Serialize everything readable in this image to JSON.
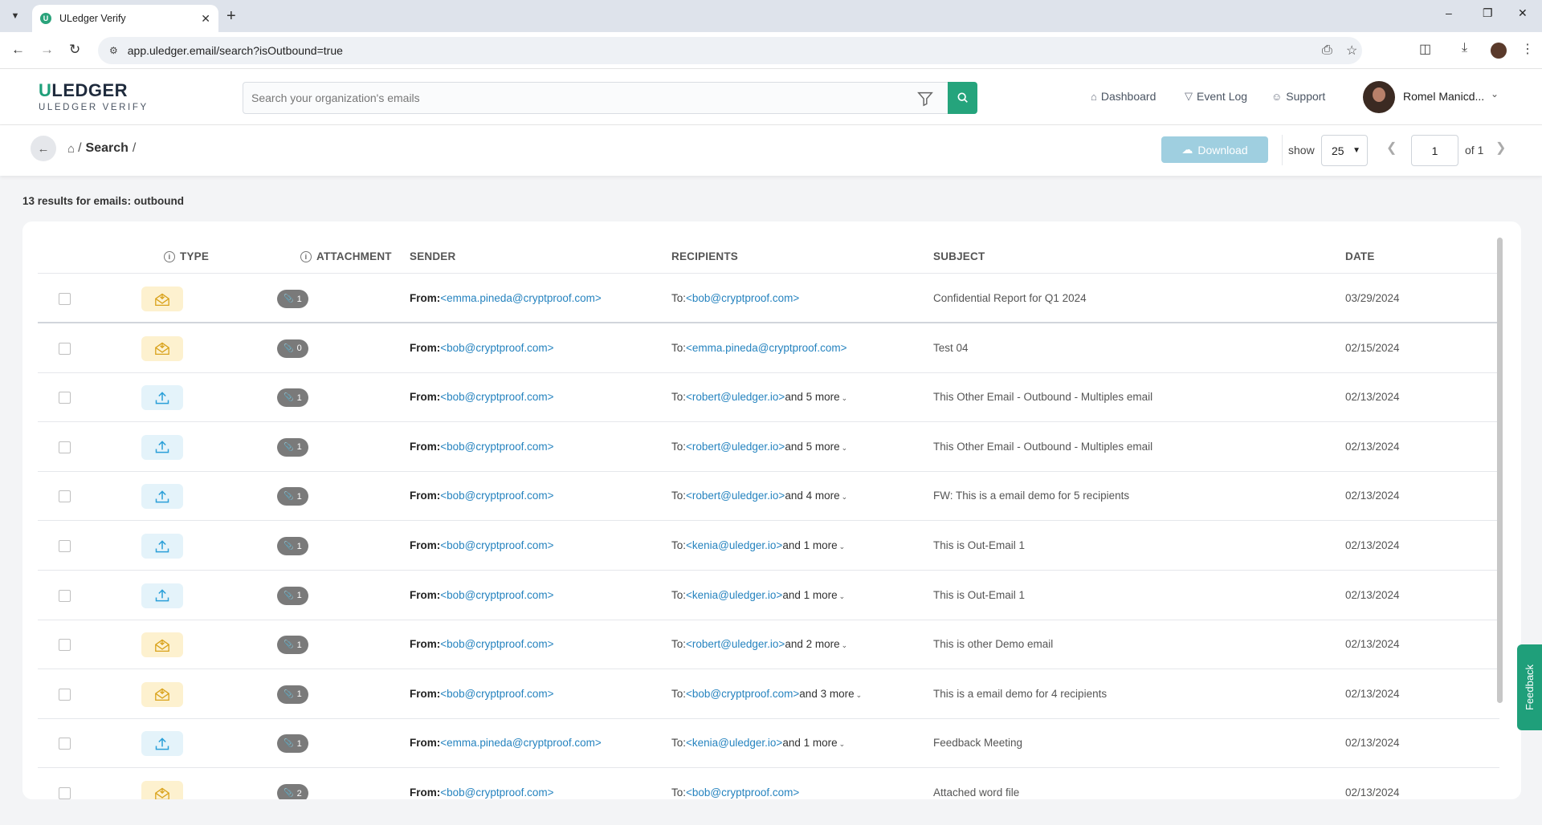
{
  "browser": {
    "tab_title": "ULedger Verify",
    "url": "app.uledger.email/search?isOutbound=true",
    "site_info_icon": "tune-icon"
  },
  "header": {
    "logo_text": "ULEDGER",
    "logo_subtitle": "ULEDGER VERIFY",
    "search_placeholder": "Search your organization's emails",
    "nav": [
      {
        "label": "Dashboard",
        "icon": "home-icon"
      },
      {
        "label": "Event Log",
        "icon": "filter-icon"
      },
      {
        "label": "Support",
        "icon": "users-icon"
      }
    ],
    "user_name": "Romel Manicd..."
  },
  "toolbar": {
    "breadcrumb_sep": "/",
    "breadcrumb_current": "Search",
    "download_label": "Download",
    "show_label": "show",
    "page_size": "25",
    "page_number": "1",
    "page_of": "of 1"
  },
  "results_text": "13 results for emails: outbound",
  "table": {
    "columns": {
      "type": "TYPE",
      "attachment": "ATTACHMENT",
      "sender": "SENDER",
      "recipients": "RECIPIENTS",
      "subject": "SUBJECT",
      "date": "DATE"
    },
    "from_prefix": "From:",
    "to_prefix": "To:",
    "rows": [
      {
        "type": "inbound",
        "attachments": "1",
        "sender": "<emma.pineda@cryptproof.com>",
        "recipient": "<bob@cryptproof.com>",
        "more": "",
        "subject": "Confidential Report for Q1 2024",
        "date": "03/29/2024"
      },
      {
        "type": "inbound",
        "attachments": "0",
        "sender": "<bob@cryptproof.com>",
        "recipient": "<emma.pineda@cryptproof.com>",
        "more": "",
        "subject": "Test 04",
        "date": "02/15/2024"
      },
      {
        "type": "outbound",
        "attachments": "1",
        "sender": "<bob@cryptproof.com>",
        "recipient": "<robert@uledger.io>",
        "more": "and 5 more",
        "subject": "This Other Email - Outbound - Multiples email",
        "date": "02/13/2024"
      },
      {
        "type": "outbound",
        "attachments": "1",
        "sender": "<bob@cryptproof.com>",
        "recipient": "<robert@uledger.io>",
        "more": "and 5 more",
        "subject": "This Other Email - Outbound - Multiples email",
        "date": "02/13/2024"
      },
      {
        "type": "outbound",
        "attachments": "1",
        "sender": "<bob@cryptproof.com>",
        "recipient": "<robert@uledger.io>",
        "more": "and 4 more",
        "subject": "FW: This is a email demo for 5 recipients",
        "date": "02/13/2024"
      },
      {
        "type": "outbound",
        "attachments": "1",
        "sender": "<bob@cryptproof.com>",
        "recipient": "<kenia@uledger.io>",
        "more": "and 1 more",
        "subject": "This is Out-Email 1",
        "date": "02/13/2024"
      },
      {
        "type": "outbound",
        "attachments": "1",
        "sender": "<bob@cryptproof.com>",
        "recipient": "<kenia@uledger.io>",
        "more": "and 1 more",
        "subject": "This is Out-Email 1",
        "date": "02/13/2024"
      },
      {
        "type": "inbound",
        "attachments": "1",
        "sender": "<bob@cryptproof.com>",
        "recipient": "<robert@uledger.io>",
        "more": "and 2 more",
        "subject": "This is other Demo email",
        "date": "02/13/2024"
      },
      {
        "type": "inbound",
        "attachments": "1",
        "sender": "<bob@cryptproof.com>",
        "recipient": "<bob@cryptproof.com>",
        "more": "and 3 more",
        "subject": "This is a email demo for 4 recipients",
        "date": "02/13/2024"
      },
      {
        "type": "outbound",
        "attachments": "1",
        "sender": "<emma.pineda@cryptproof.com>",
        "recipient": "<kenia@uledger.io>",
        "more": "and 1 more",
        "subject": "Feedback Meeting",
        "date": "02/13/2024"
      },
      {
        "type": "inbound",
        "attachments": "2",
        "sender": "<bob@cryptproof.com>",
        "recipient": "<bob@cryptproof.com>",
        "more": "",
        "subject": "Attached word file",
        "date": "02/13/2024"
      }
    ]
  },
  "feedback_label": "Feedback",
  "colors": {
    "brand_green": "#25a47c",
    "link_blue": "#2583bf",
    "inbound_badge_bg": "#fdf1cf",
    "outbound_badge_bg": "#e4f3fa",
    "download_btn": "#9fcfe0"
  }
}
